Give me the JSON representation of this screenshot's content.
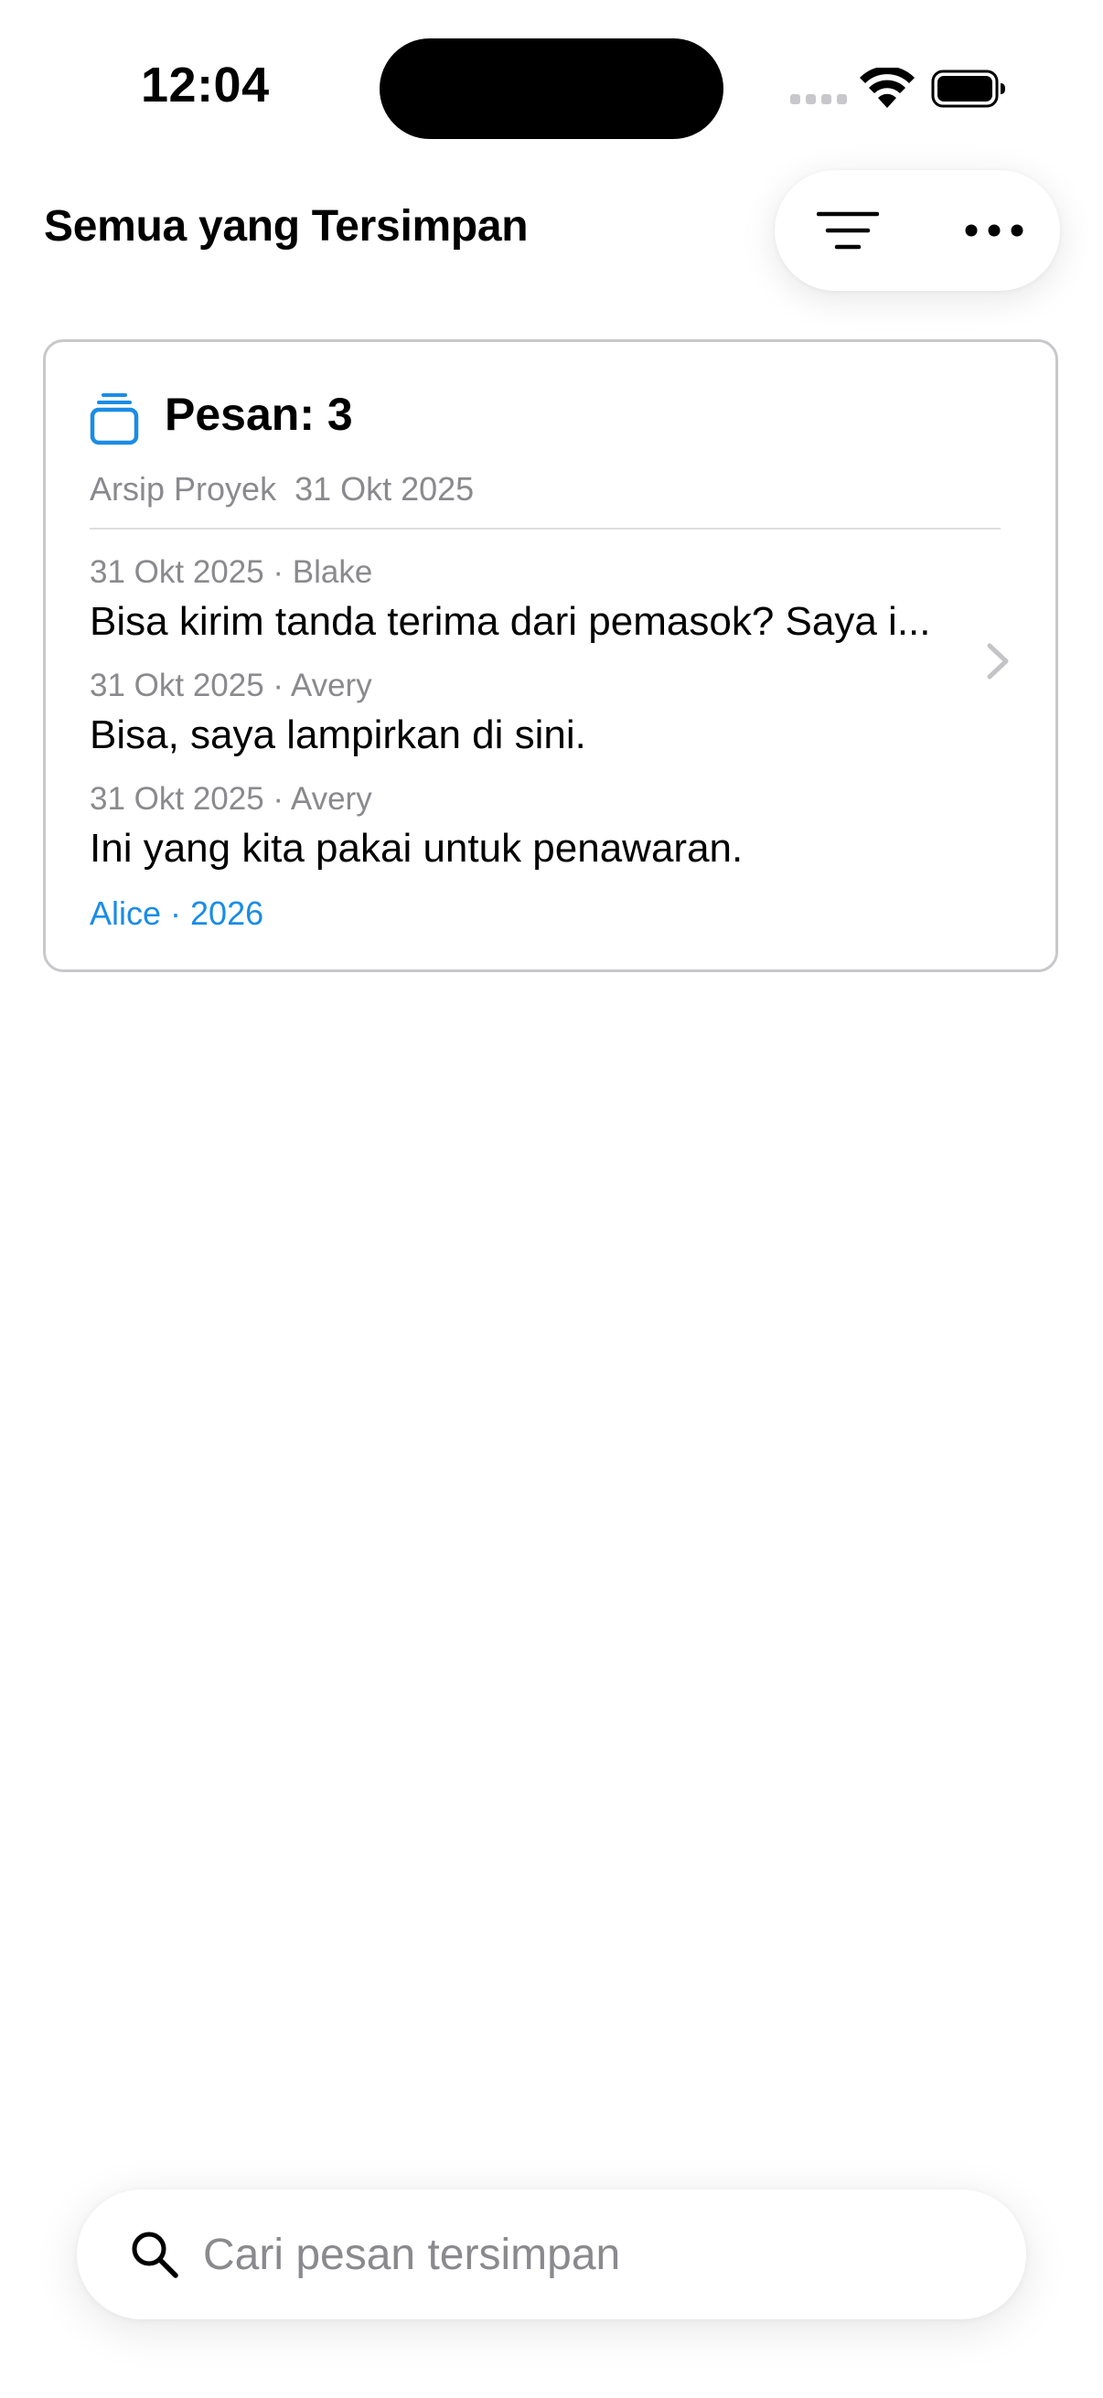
{
  "status_bar": {
    "time": "12:04"
  },
  "header": {
    "title": "Semua yang Tersimpan",
    "filter_icon": "filter-lines-icon",
    "more_icon": "ellipsis-icon"
  },
  "card": {
    "icon": "stack-icon",
    "title": "Pesan: 3",
    "subtitle": "Arsip Proyek  31 Okt 2025",
    "messages": [
      {
        "meta": "31 Okt 2025 · Blake",
        "text": "Bisa kirim tanda terima dari pemasok? Saya i..."
      },
      {
        "meta": "31 Okt 2025 · Avery",
        "text": "Bisa, saya lampirkan di sini."
      },
      {
        "meta": "31 Okt 2025 · Avery",
        "text": "Ini yang kita pakai untuk penawaran."
      }
    ],
    "footer": "Alice · 2026"
  },
  "search": {
    "placeholder": "Cari pesan tersimpan",
    "value": ""
  },
  "colors": {
    "accent": "#1a8ce6",
    "secondary_text": "#8a8a8e",
    "border": "#c8c8cc"
  }
}
